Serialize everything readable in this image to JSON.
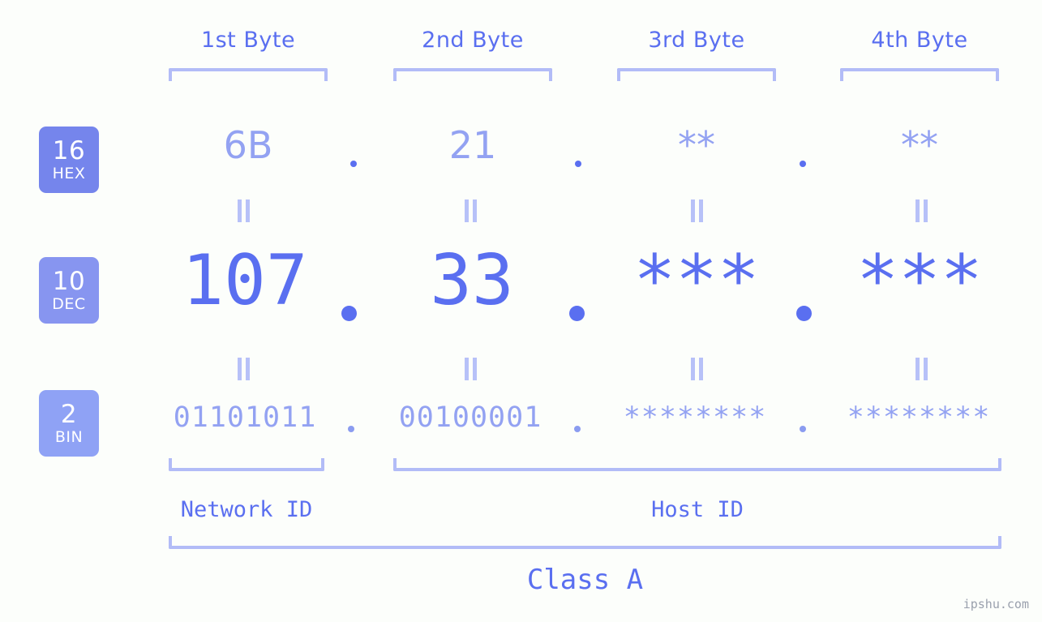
{
  "background_color": "#fcfefb",
  "accent_color": "#5a6ff0",
  "accent_light_color": "#93a2f2",
  "bracket_color": "#b2bcf7",
  "header": {
    "bytes": [
      {
        "label": "1st Byte"
      },
      {
        "label": "2nd Byte"
      },
      {
        "label": "3rd Byte"
      },
      {
        "label": "4th Byte"
      }
    ]
  },
  "bases": [
    {
      "num": "16",
      "name": "HEX",
      "color": "#7585ec"
    },
    {
      "num": "10",
      "name": "DEC",
      "color": "#8795f0"
    },
    {
      "num": "2",
      "name": "BIN",
      "color": "#8fa2f5"
    }
  ],
  "rows": {
    "hex": {
      "base_num": "16",
      "base_name": "HEX",
      "values": [
        "6B",
        "21",
        "**",
        "**"
      ],
      "separator": "."
    },
    "dec": {
      "base_num": "10",
      "base_name": "DEC",
      "values": [
        "107",
        "33",
        "***",
        "***"
      ],
      "separator": "."
    },
    "bin": {
      "base_num": "2",
      "base_name": "BIN",
      "values": [
        "01101011",
        "00100001",
        "********",
        "********"
      ],
      "separator": "."
    }
  },
  "connector_symbol": "||",
  "segments": {
    "network_id": "Network ID",
    "host_id": "Host ID"
  },
  "class": {
    "label": "Class A"
  },
  "watermark": "ipshu.com"
}
